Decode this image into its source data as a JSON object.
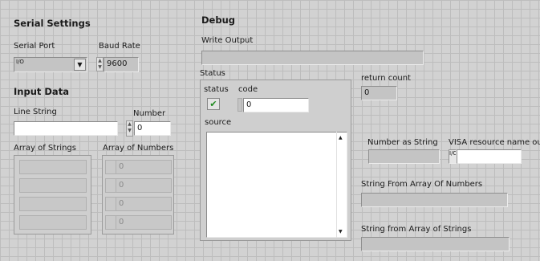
{
  "serial": {
    "title": "Serial Settings",
    "port_label": "Serial Port",
    "port_icon": "I/O",
    "baud_label": "Baud Rate",
    "baud_value": "9600"
  },
  "input": {
    "title": "Input Data",
    "line_label": "Line String",
    "number_label": "Number",
    "number_value": "0",
    "arr_strings_label": "Array of Strings",
    "arr_numbers_label": "Array of Numbers",
    "arr_numbers_values": [
      "0",
      "0",
      "0",
      "0"
    ]
  },
  "debug": {
    "title": "Debug",
    "write_label": "Write Output",
    "status_cluster_label": "Status",
    "status_label": "status",
    "code_label": "code",
    "code_value": "0",
    "source_label": "source",
    "return_label": "return count",
    "return_value": "0",
    "num_string_label": "Number as String",
    "visa_label": "VISA resource name out",
    "visa_icon": "I/O",
    "str_from_nums_label": "String From Array Of Numbers",
    "str_from_strings_label": "String from Array of Strings"
  },
  "icons": {
    "spin_up": "▲",
    "spin_down": "▼",
    "dropdown_arrow": "▼",
    "status_check": "✔",
    "scroll_up": "▲",
    "scroll_down": "▼"
  },
  "colors": {
    "panel_bg": "#d2d2d2",
    "grid_line": "#bdbdbd",
    "status_ok": "#1e8a1e"
  }
}
